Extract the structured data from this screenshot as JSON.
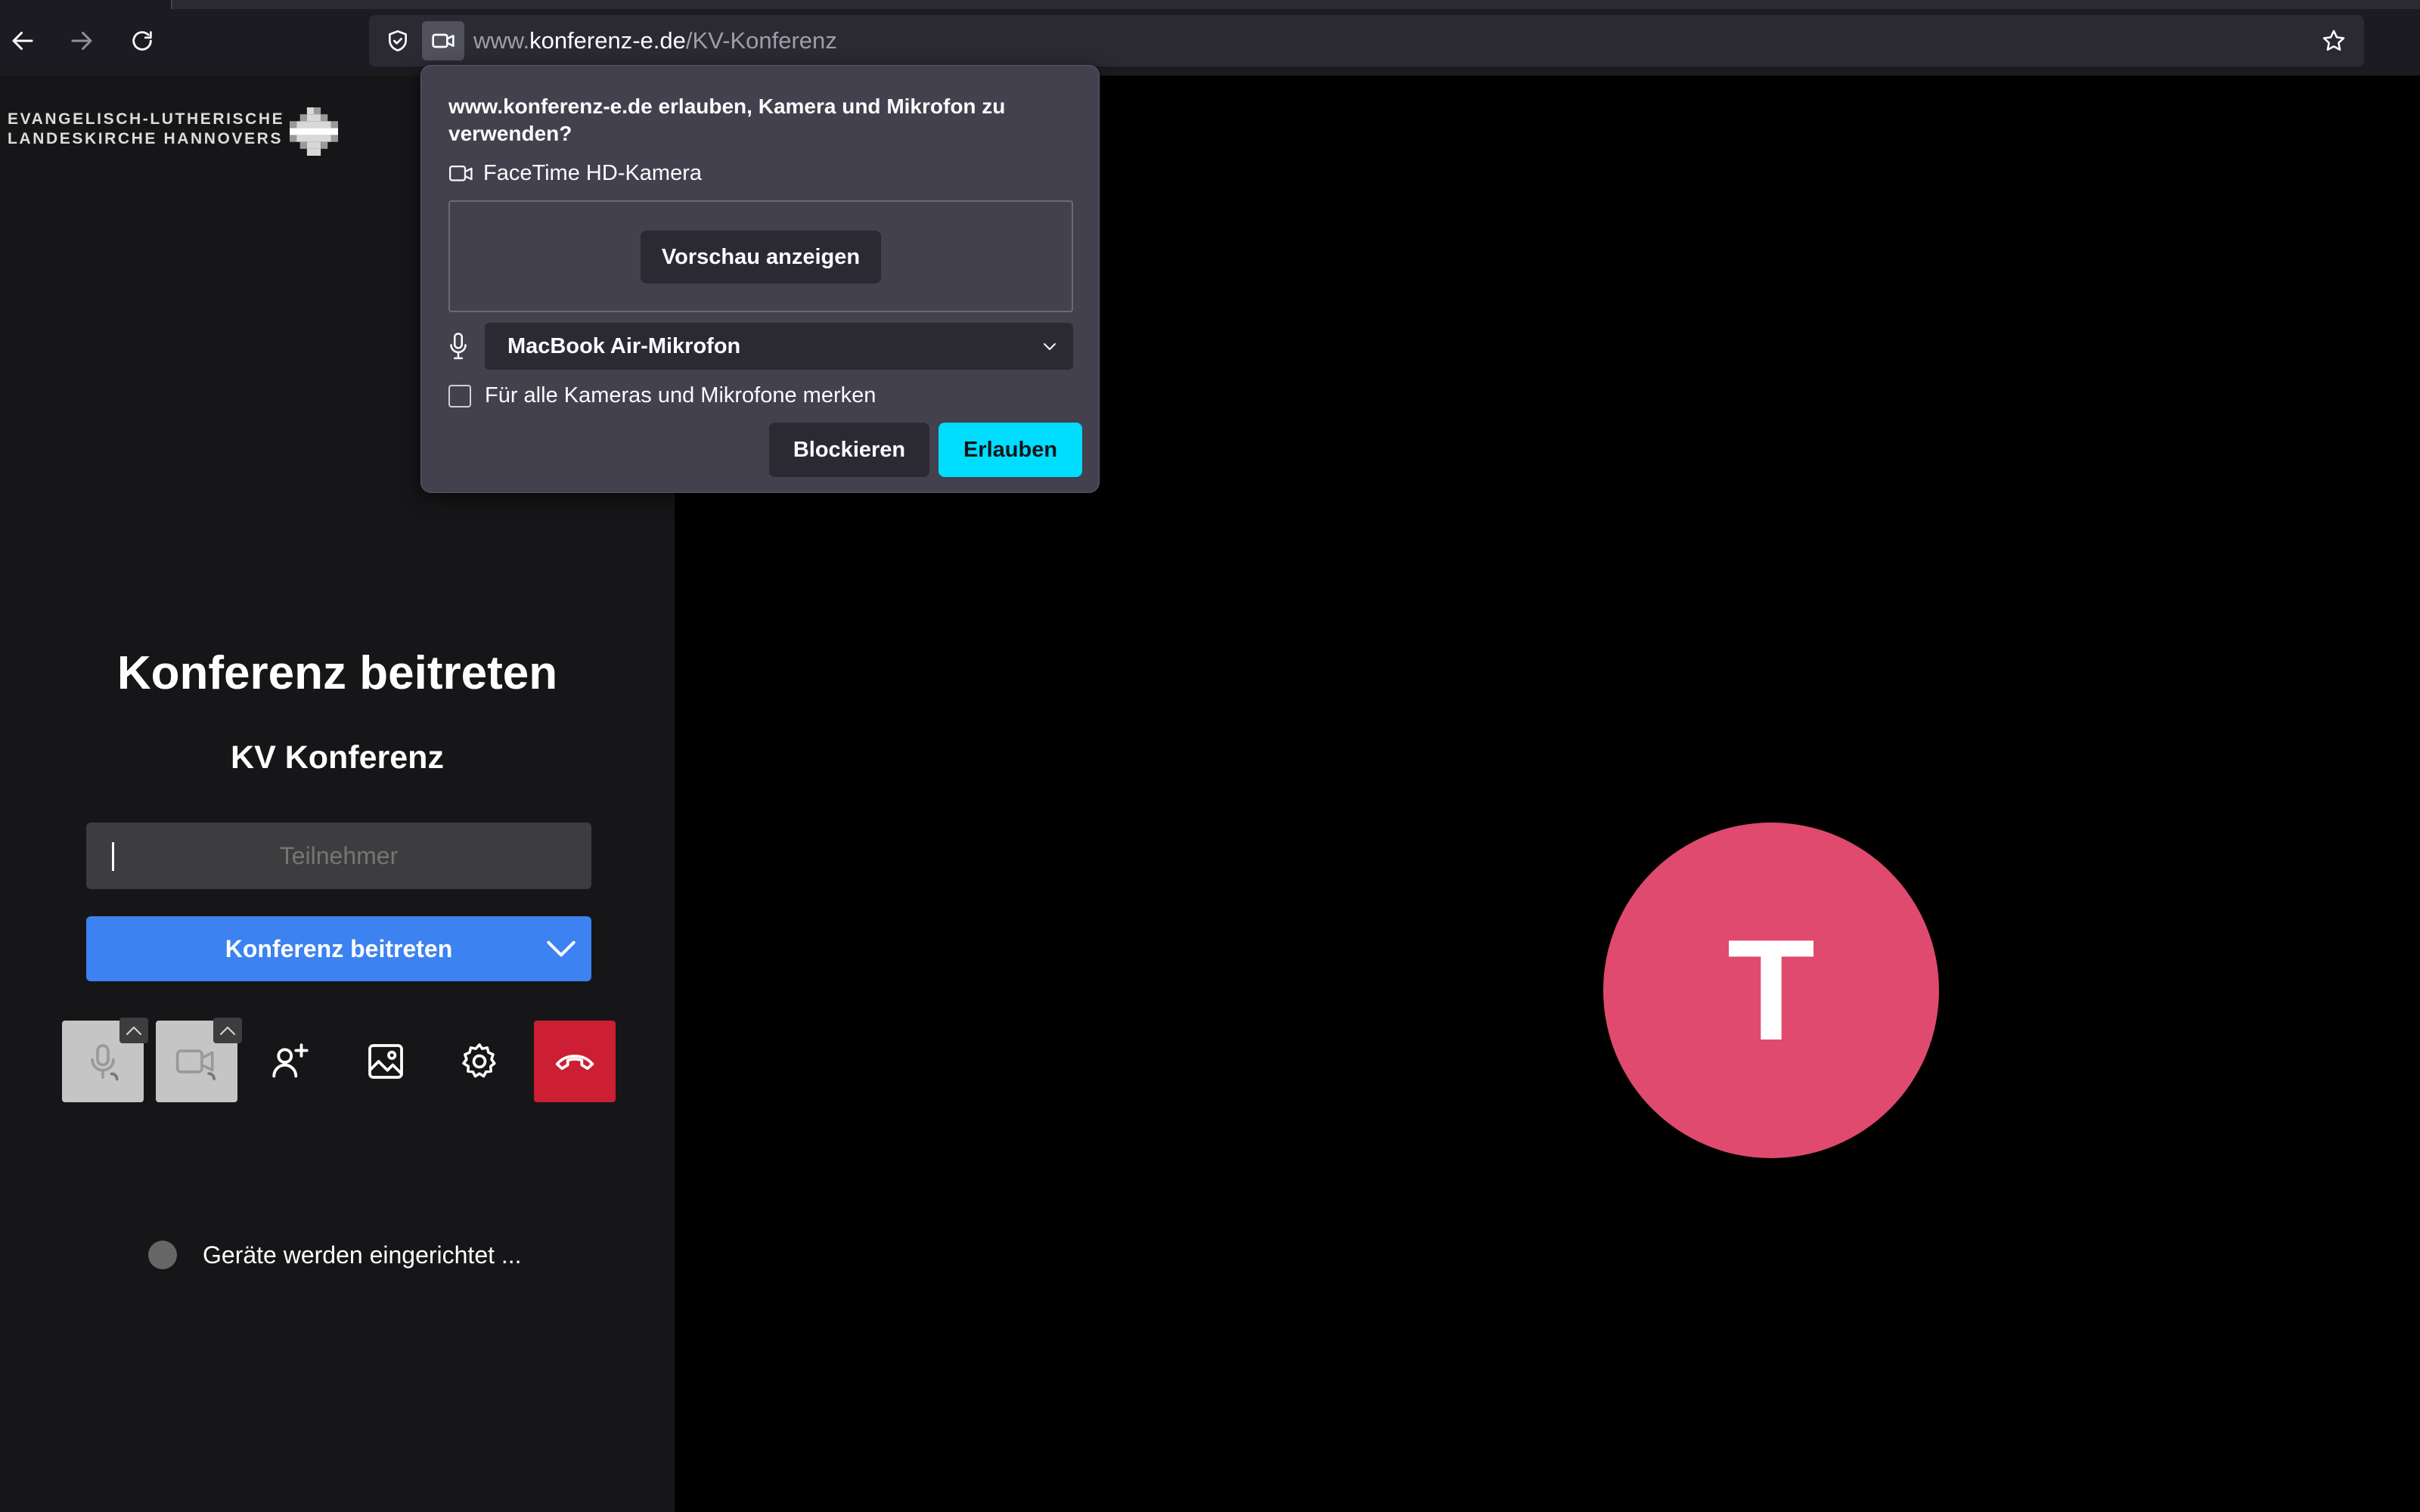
{
  "browser": {
    "url_prefix": "www.",
    "url_host": "konferenz-e.de",
    "url_path": "/KV-Konferenz"
  },
  "permission_popup": {
    "question": "www.konferenz-e.de erlauben, Kamera und Mikrofon zu verwenden?",
    "camera_name": "FaceTime HD-Kamera",
    "preview_button": "Vorschau anzeigen",
    "microphone_selected": "MacBook Air-Mikrofon",
    "remember_label": "Für alle Kameras und Mikrofone merken",
    "remember_checked": false,
    "block_button": "Blockieren",
    "allow_button": "Erlauben"
  },
  "logo": {
    "line1": "EVANGELISCH-LUTHERISCHE",
    "line2": "LANDESKIRCHE HANNOVERS"
  },
  "prejoin": {
    "title": "Konferenz beitreten",
    "room_name": "KV Konferenz",
    "name_placeholder": "Teilnehmer",
    "join_button": "Konferenz beitreten",
    "status_text": "Geräte werden eingerichtet ..."
  },
  "avatar": {
    "initial": "T",
    "color": "#e04a6e"
  },
  "colors": {
    "join_button": "#3c82f0",
    "allow_button": "#00ddff",
    "hangup_button": "#cc1f34"
  }
}
